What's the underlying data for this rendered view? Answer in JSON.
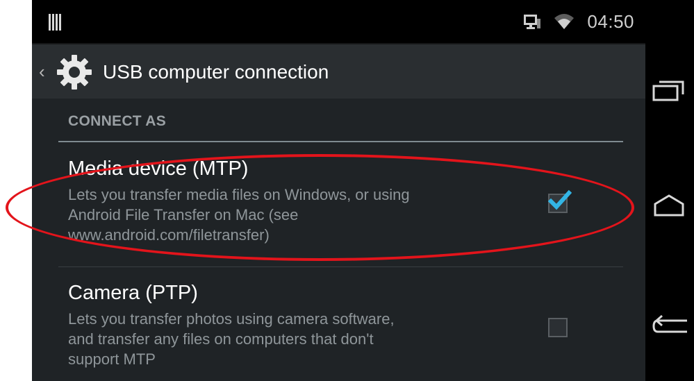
{
  "status_bar": {
    "time": "04:50",
    "icons": [
      "notification-bars-icon",
      "screen-icon",
      "wifi-icon"
    ]
  },
  "action_bar": {
    "back_glyph": "‹",
    "title": "USB computer connection",
    "icon": "settings-gear-icon"
  },
  "section": {
    "header": "CONNECT AS"
  },
  "options": [
    {
      "title": "Media device (MTP)",
      "description_lines": [
        "Lets you transfer media files on Windows, or using",
        "Android File Transfer on Mac (see",
        "www.android.com/filetransfer)"
      ],
      "checked": true
    },
    {
      "title": "Camera (PTP)",
      "description_lines": [
        "Lets you transfer photos using camera software,",
        "and transfer any files on computers that don't",
        "support MTP"
      ],
      "checked": false
    }
  ],
  "nav_bar": {
    "buttons": [
      "recent-apps-icon",
      "home-icon",
      "back-icon"
    ]
  },
  "colors": {
    "accent_check": "#33b5e5",
    "highlight": "#e3141b",
    "background": "#1f2326"
  }
}
